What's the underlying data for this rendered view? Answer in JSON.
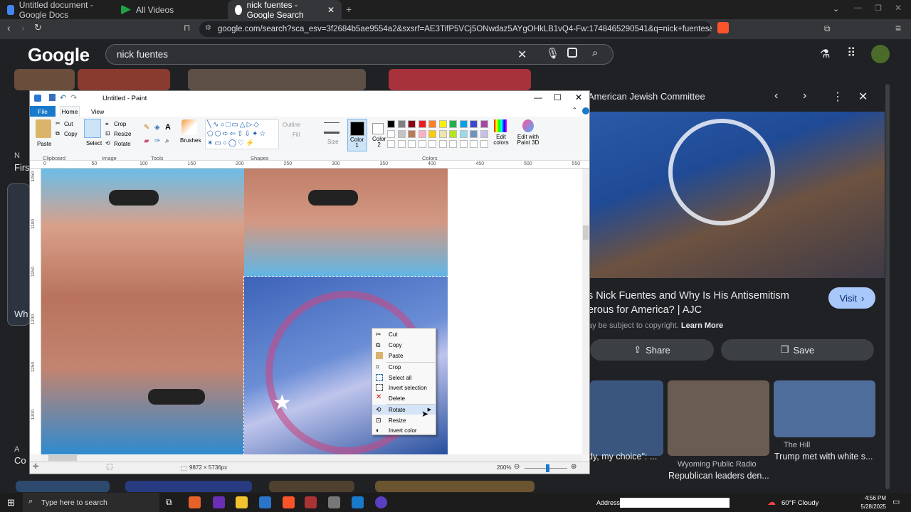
{
  "browser": {
    "tabs": [
      {
        "label": "Untitled document - Google Docs",
        "active": false
      },
      {
        "label": "All Videos",
        "active": false
      },
      {
        "label": "nick fuentes - Google Search",
        "active": true
      }
    ],
    "url": "google.com/search?sca_esv=3f2684b5ae9554a2&sxsrf=AE3TifP5VCj5ONwdaz5AYgOHkLB1vQ4-Fw:1748465290541&q=nick+fuentes&udm=2&..."
  },
  "google": {
    "logo": "Google",
    "query": "nick fuentes",
    "left_snippets": [
      "N",
      "First",
      "Wh",
      "A",
      "Co"
    ]
  },
  "panel": {
    "source": "American Jewish Committee",
    "title_line1": "s Nick Fuentes and Why Is His Antisemitism",
    "title_line2": "erous for America? | AJC",
    "copyright": "ay be subject to copyright.",
    "learn_more": "Learn More",
    "visit": "Visit",
    "share": "Share",
    "save": "Save",
    "related": [
      {
        "caption": "dy, my choice\": ...",
        "source": ""
      },
      {
        "caption": "Republican leaders den...",
        "source": "Wyoming Public Radio"
      },
      {
        "caption": "Trump met with white s...",
        "source": "The Hill"
      }
    ]
  },
  "paint": {
    "title": "Untitled - Paint",
    "menu": {
      "file": "File",
      "home": "Home",
      "view": "View"
    },
    "clipboard": {
      "paste": "Paste",
      "cut": "Cut",
      "copy": "Copy",
      "group": "Clipboard"
    },
    "image": {
      "select": "Select",
      "crop": "Crop",
      "resize": "Resize",
      "rotate": "Rotate",
      "group": "Image"
    },
    "tools_group": "Tools",
    "brushes": "Brushes",
    "shapes": {
      "outline": "Outline",
      "fill": "Fill",
      "group": "Shapes"
    },
    "size": "Size",
    "color1": "Color\n1",
    "color2": "Color\n2",
    "colors_group": "Colors",
    "edit_colors": "Edit colors",
    "edit_3d": "Edit with Paint 3D",
    "ruler_ticks": [
      "0",
      "50",
      "100",
      "150",
      "200",
      "250",
      "300",
      "350",
      "400",
      "450",
      "500",
      "550"
    ],
    "vruler_ticks": [
      "1050",
      "1100",
      "1150",
      "1200",
      "1250",
      "1300"
    ],
    "status_size": "9872 × 5736px",
    "zoom": "200%",
    "palette": [
      "#000000",
      "#7f7f7f",
      "#880015",
      "#ed1c24",
      "#ff7f27",
      "#fff200",
      "#22b14c",
      "#00a2e8",
      "#3f48cc",
      "#a349a4",
      "#ffffff",
      "#c3c3c3",
      "#b97a57",
      "#ffaec9",
      "#ffc90e",
      "#efe4b0",
      "#b5e61d",
      "#99d9ea",
      "#7092be",
      "#c8bfe7"
    ]
  },
  "context_menu": {
    "items": [
      "Cut",
      "Copy",
      "Paste",
      "Crop",
      "Select all",
      "Invert selection",
      "Delete",
      "Rotate",
      "Resize",
      "Invert color"
    ]
  },
  "taskbar": {
    "search": "Type here to search",
    "address_label": "Address",
    "weather": "60°F  Cloudy",
    "time": "4:56 PM",
    "date": "5/28/2025"
  }
}
